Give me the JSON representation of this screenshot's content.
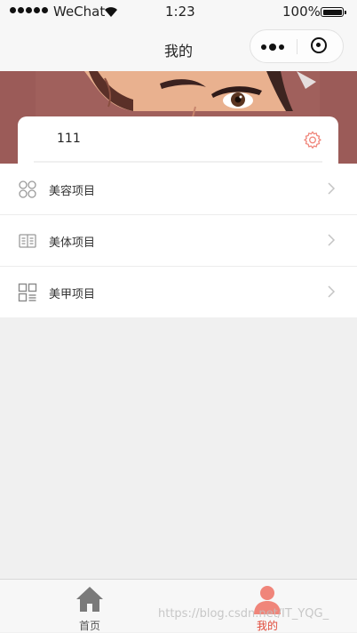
{
  "status_bar": {
    "carrier": "WeChat",
    "time": "1:23",
    "battery": "100%"
  },
  "navbar": {
    "title": "我的"
  },
  "profile": {
    "username": "111"
  },
  "menu": {
    "items": [
      {
        "label": "美容项目",
        "icon": "flower-grid-icon"
      },
      {
        "label": "美体项目",
        "icon": "book-icon"
      },
      {
        "label": "美甲项目",
        "icon": "apps-list-icon"
      }
    ]
  },
  "tabbar": {
    "tabs": [
      {
        "label": "首页",
        "icon": "home-icon",
        "active": false
      },
      {
        "label": "我的",
        "icon": "user-icon",
        "active": true
      }
    ]
  },
  "watermark": "https://blog.csdn.net/IT_YQG_",
  "colors": {
    "accent": "#f0857a",
    "active_tab_text": "#e04a3a",
    "inactive_icon": "#7a7a7a",
    "page_background": "#f0f0f0"
  }
}
